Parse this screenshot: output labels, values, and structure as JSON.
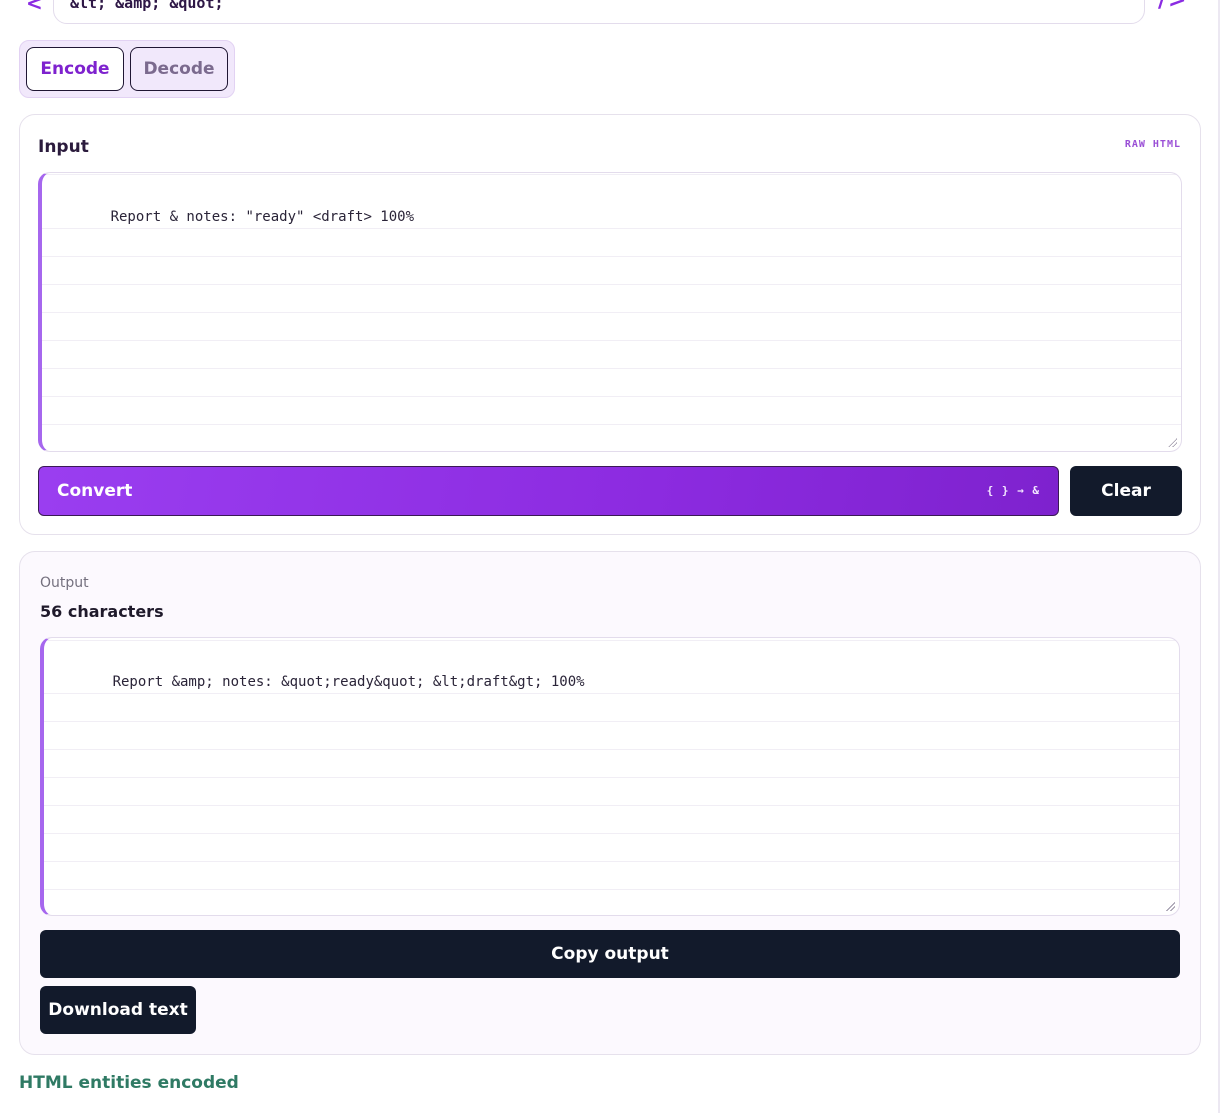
{
  "header": {
    "banner_text": "&lt; &amp; &quot;",
    "left_glyph": "<",
    "right_glyph": "/>"
  },
  "mode": {
    "encode_label": "Encode",
    "decode_label": "Decode",
    "selected": "Encode"
  },
  "input": {
    "title": "Input",
    "badge": "RAW HTML",
    "value": "Report & notes: \"ready\" <draft> 100%",
    "convert_label": "Convert",
    "convert_hint": "{ } → &",
    "clear_label": "Clear"
  },
  "output": {
    "label": "Output",
    "count": "56 characters",
    "value": "Report &amp; notes: &quot;ready&quot; &lt;draft&gt; 100%",
    "copy_label": "Copy output",
    "download_label": "Download text"
  },
  "status": {
    "message": "HTML entities encoded",
    "color": "#2f7a64"
  },
  "colors": {
    "accent": "#7e22ce",
    "dark_button": "#121a2b"
  }
}
